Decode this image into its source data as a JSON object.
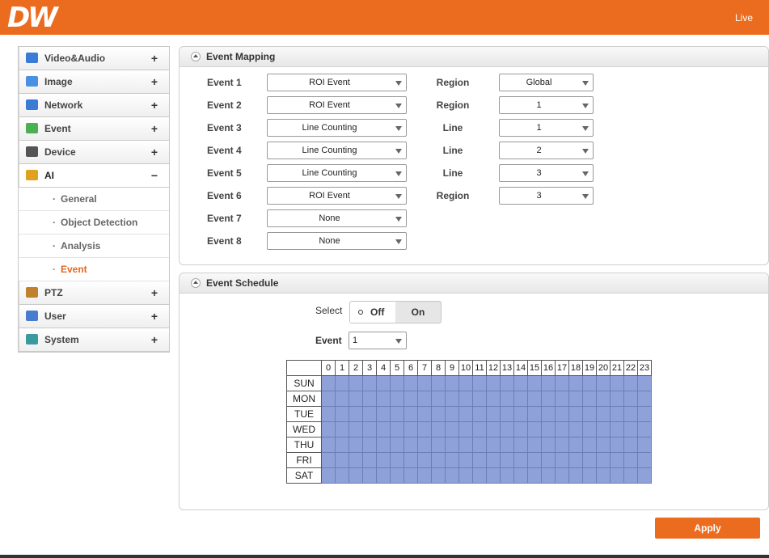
{
  "header": {
    "logo": "DW",
    "live_label": "Live"
  },
  "colors": {
    "brand": "#ec6c1f",
    "schedule_cell": "#8ea2d9",
    "active_sub": "#e5661d"
  },
  "sidebar": {
    "items": [
      {
        "label": "Video&Audio",
        "icon": "video-audio-icon",
        "expander": "+"
      },
      {
        "label": "Image",
        "icon": "image-icon",
        "expander": "+"
      },
      {
        "label": "Network",
        "icon": "network-icon",
        "expander": "+"
      },
      {
        "label": "Event",
        "icon": "event-icon",
        "expander": "+"
      },
      {
        "label": "Device",
        "icon": "device-icon",
        "expander": "+"
      },
      {
        "label": "AI",
        "icon": "ai-icon",
        "expander": "−"
      },
      {
        "label": "PTZ",
        "icon": "ptz-icon",
        "expander": "+"
      },
      {
        "label": "User",
        "icon": "user-icon",
        "expander": "+"
      },
      {
        "label": "System",
        "icon": "system-icon",
        "expander": "+"
      }
    ],
    "ai_sub": [
      {
        "label": "General"
      },
      {
        "label": "Object Detection"
      },
      {
        "label": "Analysis"
      },
      {
        "label": "Event"
      }
    ],
    "sub_bullet": "·"
  },
  "mapping": {
    "title": "Event Mapping",
    "rows": [
      {
        "label": "Event 1",
        "value": "ROI Event",
        "sub_label": "Region",
        "sub_value": "Global"
      },
      {
        "label": "Event 2",
        "value": "ROI Event",
        "sub_label": "Region",
        "sub_value": "1"
      },
      {
        "label": "Event 3",
        "value": "Line Counting",
        "sub_label": "Line",
        "sub_value": "1"
      },
      {
        "label": "Event 4",
        "value": "Line Counting",
        "sub_label": "Line",
        "sub_value": "2"
      },
      {
        "label": "Event 5",
        "value": "Line Counting",
        "sub_label": "Line",
        "sub_value": "3"
      },
      {
        "label": "Event 6",
        "value": "ROI Event",
        "sub_label": "Region",
        "sub_value": "3"
      },
      {
        "label": "Event 7",
        "value": "None"
      },
      {
        "label": "Event 8",
        "value": "None"
      }
    ]
  },
  "schedule": {
    "title": "Event Schedule",
    "select_label": "Select",
    "off_label": "Off",
    "on_label": "On",
    "event_label": "Event",
    "event_value": "1",
    "hours": [
      "0",
      "1",
      "2",
      "3",
      "4",
      "5",
      "6",
      "7",
      "8",
      "9",
      "10",
      "11",
      "12",
      "13",
      "14",
      "15",
      "16",
      "17",
      "18",
      "19",
      "20",
      "21",
      "22",
      "23"
    ],
    "days": [
      "SUN",
      "MON",
      "TUE",
      "WED",
      "THU",
      "FRI",
      "SAT"
    ]
  },
  "apply_label": "Apply"
}
